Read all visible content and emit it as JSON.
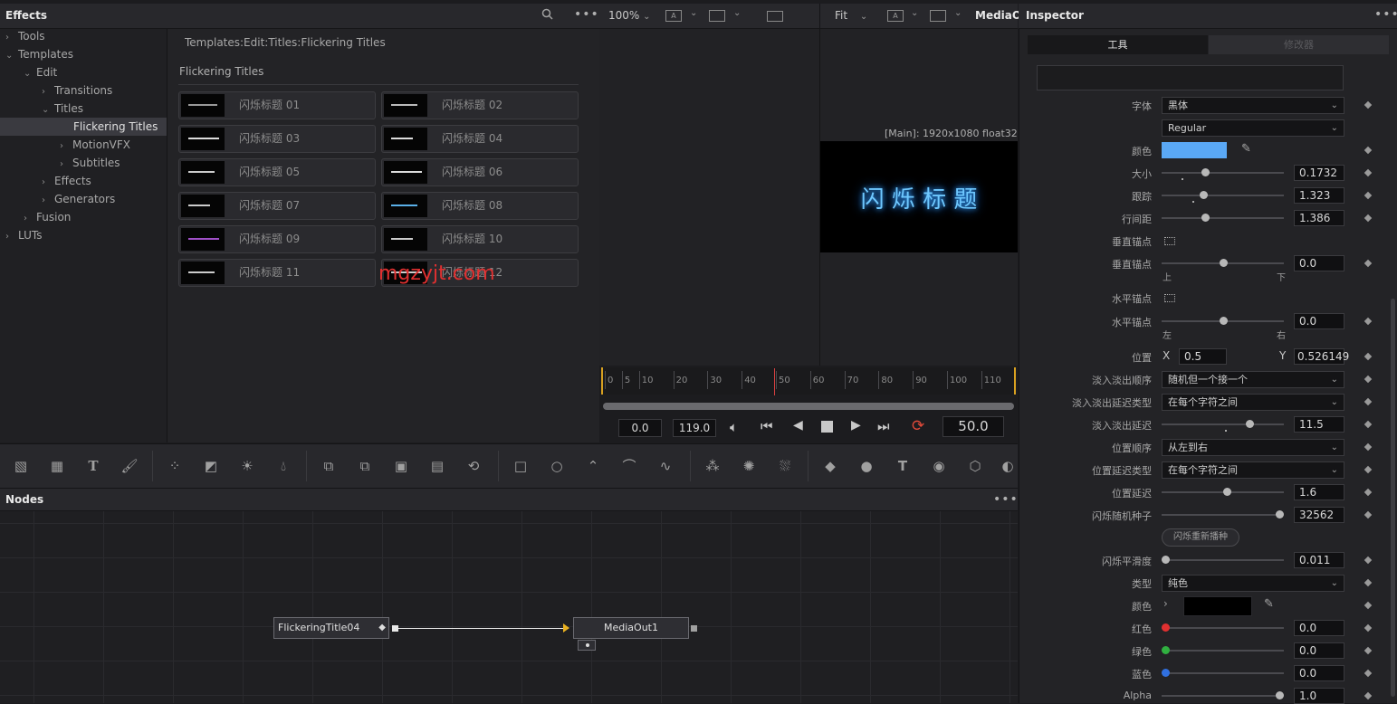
{
  "effects": {
    "title": "Effects",
    "tree": [
      {
        "label": "Tools",
        "chev": "›"
      },
      {
        "label": "Templates",
        "chev": "⌄"
      },
      {
        "label": "Edit",
        "chev": "⌄"
      },
      {
        "label": "Transitions",
        "chev": "›"
      },
      {
        "label": "Titles",
        "chev": "⌄"
      },
      {
        "label": "Flickering Titles",
        "chev": ""
      },
      {
        "label": "MotionVFX",
        "chev": "›"
      },
      {
        "label": "Subtitles",
        "chev": "›"
      },
      {
        "label": "Effects",
        "chev": "›"
      },
      {
        "label": "Generators",
        "chev": "›"
      },
      {
        "label": "Fusion",
        "chev": "›"
      },
      {
        "label": "LUTs",
        "chev": "›"
      }
    ],
    "breadcrumb": "Templates:Edit:Titles:Flickering Titles",
    "section": "Flickering Titles",
    "tiles": [
      "闪烁标题 01",
      "闪烁标题 02",
      "闪烁标题 03",
      "闪烁标题 04",
      "闪烁标题 05",
      "闪烁标题 06",
      "闪烁标题 07",
      "闪烁标题 08",
      "闪烁标题 09",
      "闪烁标题 10",
      "闪烁标题 11",
      "闪烁标题 12"
    ],
    "watermark": "mgzyjt.com"
  },
  "viewer": {
    "zoom": "100%",
    "fit": "Fit",
    "output_name": "MediaO",
    "resolution": "[Main]: 1920x1080 float32",
    "preview_text": "闪 烁 标 题",
    "ruler": [
      "0",
      "5",
      "10",
      "20",
      "30",
      "40",
      "50",
      "60",
      "70",
      "80",
      "90",
      "100",
      "110"
    ],
    "start": "0.0",
    "end": "119.0",
    "current": "50.0"
  },
  "nodes": {
    "title": "Nodes",
    "node1": "FlickeringTitle04",
    "node2": "MediaOut1"
  },
  "inspector": {
    "title": "Inspector",
    "tab_tools": "工具",
    "tab_modifiers": "修改器",
    "font_label": "字体",
    "font_value": "黑体",
    "style_value": "Regular",
    "color_label": "颜色",
    "color_hex": "#5aa8f5",
    "size_label": "大小",
    "size_value": "0.1732",
    "tracking_label": "跟踪",
    "tracking_value": "1.323",
    "linespacing_label": "行间距",
    "linespacing_value": "1.386",
    "v_anchor_label": "垂直锚点",
    "v_anchor2_label": "垂直锚点",
    "v_anchor_value": "0.0",
    "v_top": "上",
    "v_bottom": "下",
    "h_anchor_label": "水平锚点",
    "h_anchor2_label": "水平锚点",
    "h_anchor_value": "0.0",
    "h_left": "左",
    "h_right": "右",
    "pos_label": "位置",
    "pos_x_label": "X",
    "pos_x": "0.5",
    "pos_y_label": "Y",
    "pos_y": "0.526149",
    "fade_order_label": "淡入淡出顺序",
    "fade_order_value": "随机但一个接一个",
    "fade_delay_type_label": "淡入淡出延迟类型",
    "fade_delay_type_value": "在每个字符之间",
    "fade_delay_label": "淡入淡出延迟",
    "fade_delay_value": "11.5",
    "pos_order_label": "位置顺序",
    "pos_order_value": "从左到右",
    "pos_delay_type_label": "位置延迟类型",
    "pos_delay_type_value": "在每个字符之间",
    "pos_delay_label": "位置延迟",
    "pos_delay_value": "1.6",
    "seed_label": "闪烁随机种子",
    "seed_value": "32562",
    "reseed_button": "闪烁重新播种",
    "smooth_label": "闪烁平滑度",
    "smooth_value": "0.011",
    "type_label": "类型",
    "type_value": "纯色",
    "bgcolor_label": "颜色",
    "red_label": "红色",
    "red_value": "0.0",
    "green_label": "绿色",
    "green_value": "0.0",
    "blue_label": "蓝色",
    "blue_value": "0.0",
    "alpha_label": "Alpha",
    "alpha_value": "1.0"
  }
}
